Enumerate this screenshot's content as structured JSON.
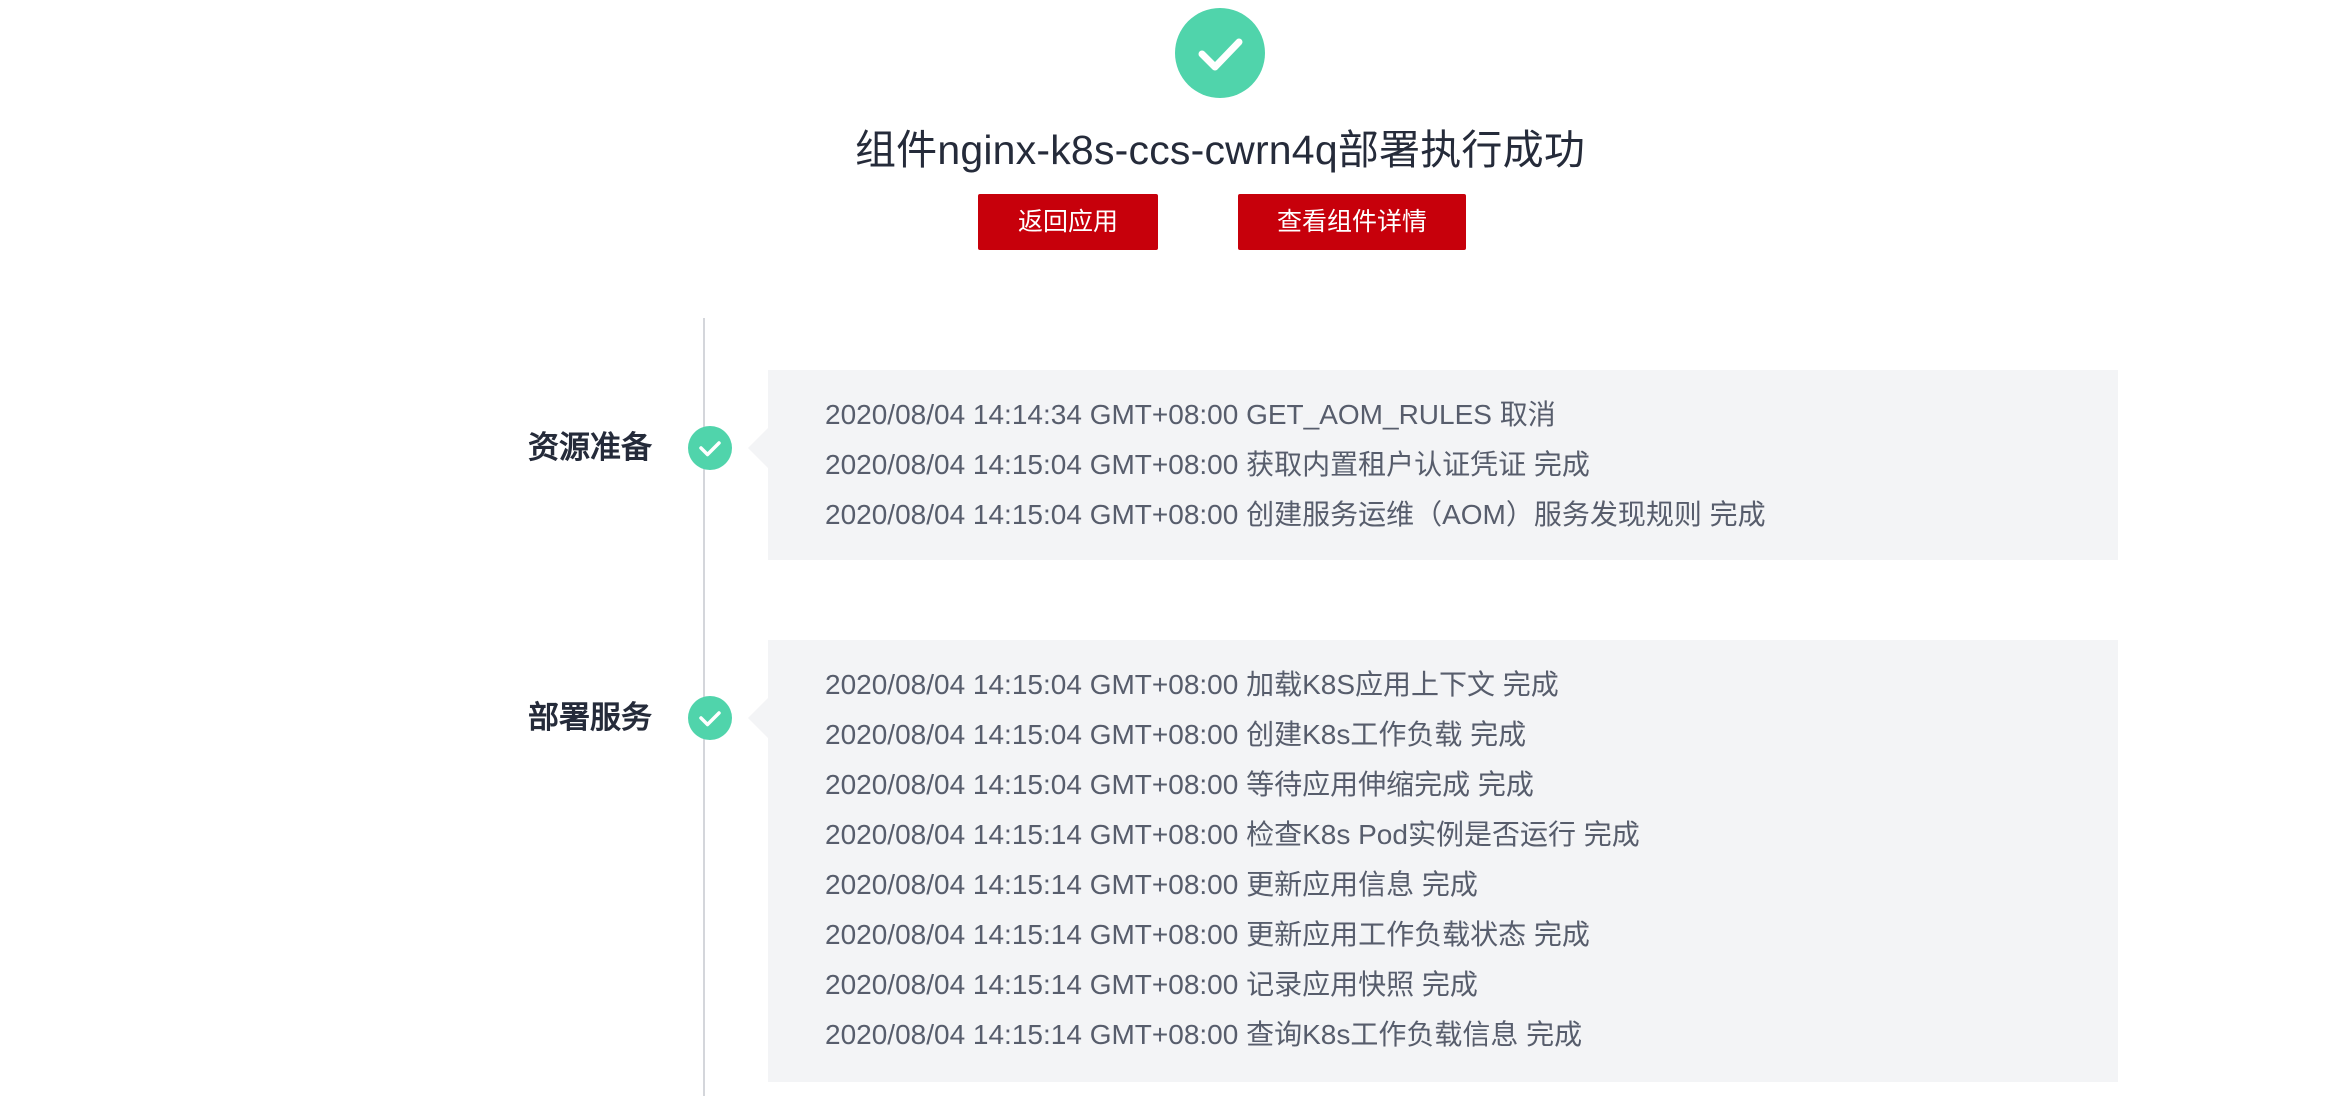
{
  "header": {
    "title": "组件nginx-k8s-ccs-cwrn4q部署执行成功",
    "status_icon": "check-circle-icon",
    "accent_color": "#50d4ab",
    "brand_color": "#c7000b"
  },
  "actions": {
    "back_label": "返回应用",
    "detail_label": "查看组件详情"
  },
  "stages": [
    {
      "label": "资源准备",
      "icon": "check-circle-icon",
      "logs": [
        "2020/08/04 14:14:34 GMT+08:00 GET_AOM_RULES 取消",
        "2020/08/04 14:15:04 GMT+08:00 获取内置租户认证凭证 完成",
        "2020/08/04 14:15:04 GMT+08:00 创建服务运维（AOM）服务发现规则 完成"
      ]
    },
    {
      "label": "部署服务",
      "icon": "check-circle-icon",
      "logs": [
        "2020/08/04 14:15:04 GMT+08:00 加载K8S应用上下文 完成",
        "2020/08/04 14:15:04 GMT+08:00 创建K8s工作负载 完成",
        "2020/08/04 14:15:04 GMT+08:00 等待应用伸缩完成 完成",
        "2020/08/04 14:15:14 GMT+08:00 检查K8s Pod实例是否运行 完成",
        "2020/08/04 14:15:14 GMT+08:00 更新应用信息 完成",
        "2020/08/04 14:15:14 GMT+08:00 更新应用工作负载状态 完成",
        "2020/08/04 14:15:14 GMT+08:00 记录应用快照 完成",
        "2020/08/04 14:15:14 GMT+08:00 查询K8s工作负载信息 完成"
      ]
    }
  ]
}
